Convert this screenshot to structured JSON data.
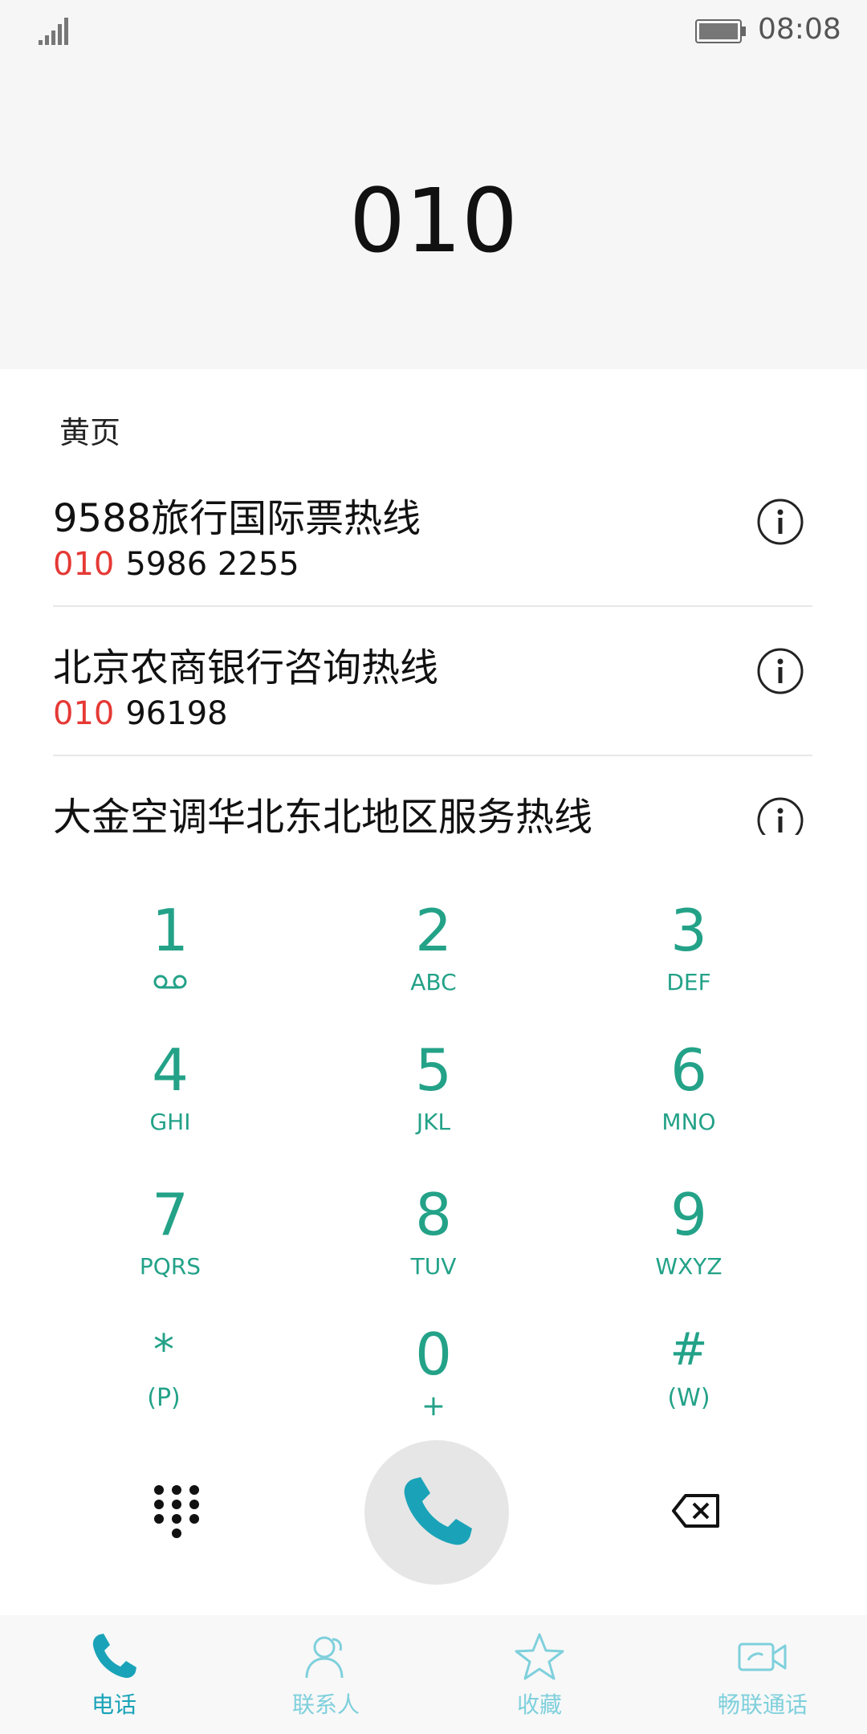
{
  "status_bar": {
    "time": "08:08"
  },
  "dialer": {
    "dialed_number": "010"
  },
  "yellow_pages": {
    "section_title": "黄页",
    "items": [
      {
        "name": "9588旅行国际票热线",
        "prefix": "010",
        "number": "5986 2255"
      },
      {
        "name": "北京农商银行咨询热线",
        "prefix": "010",
        "number": "96198"
      },
      {
        "name": "大金空调华北东北地区服务热线",
        "prefix": "",
        "number": ""
      }
    ]
  },
  "keypad": {
    "keys": [
      {
        "digit": "1",
        "letters": ""
      },
      {
        "digit": "2",
        "letters": "ABC"
      },
      {
        "digit": "3",
        "letters": "DEF"
      },
      {
        "digit": "4",
        "letters": "GHI"
      },
      {
        "digit": "5",
        "letters": "JKL"
      },
      {
        "digit": "6",
        "letters": "MNO"
      },
      {
        "digit": "7",
        "letters": "PQRS"
      },
      {
        "digit": "8",
        "letters": "TUV"
      },
      {
        "digit": "9",
        "letters": "WXYZ"
      },
      {
        "digit": "*",
        "letters": "(P)"
      },
      {
        "digit": "0",
        "letters": "+"
      },
      {
        "digit": "#",
        "letters": "(W)"
      }
    ]
  },
  "nav": {
    "tabs": [
      {
        "label": "电话",
        "icon": "phone-icon",
        "active": true
      },
      {
        "label": "联系人",
        "icon": "contacts-icon",
        "active": false
      },
      {
        "label": "收藏",
        "icon": "star-icon",
        "active": false
      },
      {
        "label": "畅联通话",
        "icon": "video-call-icon",
        "active": false
      }
    ]
  },
  "colors": {
    "accent": "#23a288",
    "nav_active": "#1aa3b8",
    "nav_inactive": "#7fd0dc",
    "prefix_highlight": "#e53935"
  }
}
